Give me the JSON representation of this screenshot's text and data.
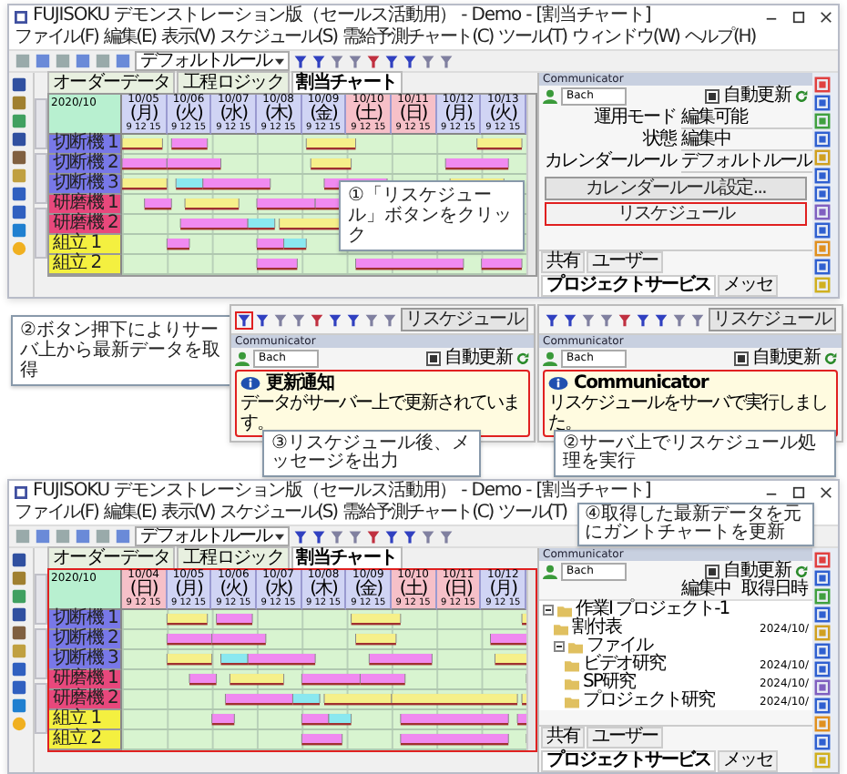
{
  "top_window": {
    "title": "FUJISOKU デモンストレーション版（セールス活動用） - Demo - [割当チャート]",
    "menu": [
      "ファイル(F)",
      "編集(E)",
      "表示(V)",
      "スケジュール(S)",
      "需給予測チャート(C)",
      "ツール(T)",
      "ウィンドウ(W)",
      "ヘルプ(H)"
    ],
    "rule_select": "デフォルトルール",
    "tabs": [
      {
        "label": "オーダーデータ",
        "selected": false
      },
      {
        "label": "工程ロジック",
        "selected": false
      },
      {
        "label": "割当チャート",
        "selected": true
      }
    ],
    "chart": {
      "corner": "2020/10",
      "days": [
        {
          "date": "10/05",
          "day": "(月)",
          "hours": "9 12 15",
          "holiday": false
        },
        {
          "date": "10/06",
          "day": "(火)",
          "hours": "9 12 15",
          "holiday": false
        },
        {
          "date": "10/07",
          "day": "(水)",
          "hours": "9 12 15",
          "holiday": false
        },
        {
          "date": "10/08",
          "day": "(木)",
          "hours": "9 12 15",
          "holiday": false
        },
        {
          "date": "10/09",
          "day": "(金)",
          "hours": "9 12 15",
          "holiday": false
        },
        {
          "date": "10/10",
          "day": "(土)",
          "hours": "9 12 15",
          "holiday": true
        },
        {
          "date": "10/11",
          "day": "(日)",
          "hours": "9 12 15",
          "holiday": true
        },
        {
          "date": "10/12",
          "day": "(月)",
          "hours": "9 12 15",
          "holiday": false
        },
        {
          "date": "10/13",
          "day": "(火)",
          "hours": "9 12 15",
          "holiday": false
        }
      ],
      "resources": [
        {
          "name": "切断機 1",
          "color": "#7878e8"
        },
        {
          "name": "切断機 2",
          "color": "#7878e8"
        },
        {
          "name": "切断機 3",
          "color": "#7878e8"
        },
        {
          "name": "研磨機 1",
          "color": "#e8487c"
        },
        {
          "name": "研磨機 2",
          "color": "#e8487c"
        },
        {
          "name": "組立 1",
          "color": "#f4f040"
        },
        {
          "name": "組立 2",
          "color": "#f4f040"
        }
      ]
    },
    "communicator": {
      "title": "Communicator",
      "user": "Bach",
      "auto_update": {
        "label": "自動更新",
        "checked": true
      },
      "fields": [
        {
          "label": "運用モード",
          "value": "編集可能"
        },
        {
          "label": "状態",
          "value": "編集中"
        },
        {
          "label": "カレンダールール",
          "value": "デフォルトルール"
        }
      ],
      "buttons": [
        {
          "label": "カレンダールール設定...",
          "highlighted": false
        },
        {
          "label": "リスケジュール",
          "highlighted": true
        }
      ],
      "tabs": [
        {
          "label": "共有",
          "selected": false
        },
        {
          "label": "ユーザー",
          "selected": false
        },
        {
          "label": "プロジェクトサービス",
          "selected": true
        },
        {
          "label": "メッセ",
          "selected": false
        }
      ]
    },
    "callout": "①「リスケジュール」ボタンをクリック"
  },
  "middle": {
    "callout_left": "②ボタン押下によりサーバ上から最新データを取得",
    "left_snippet": {
      "title": "Communicator",
      "user": "Bach",
      "auto_update": {
        "label": "自動更新",
        "checked": true
      },
      "popup": {
        "title": "更新通知",
        "message": "データがサーバー上で更新されています。"
      },
      "button": "リスケジュール"
    },
    "callout_center": "③リスケジュール後、メッセージを出力",
    "right_snippet": {
      "title": "Communicator",
      "user": "Bach",
      "auto_update": {
        "label": "自動更新",
        "checked": true
      },
      "popup": {
        "title": "Communicator",
        "message": "リスケジュールをサーバで実行しました。"
      },
      "button": "リスケジュール"
    },
    "callout_right": "②サーバ上でリスケジュール処理を実行"
  },
  "bottom_window": {
    "title": "FUJISOKU デモンストレーション版（セールス活動用） - Demo - [割当チャート]",
    "menu": [
      "ファイル(F)",
      "編集(E)",
      "表示(V)",
      "スケジュール(S)",
      "需給予測チャート(C)",
      "ツール(T)"
    ],
    "rule_select": "デフォルトルール",
    "tabs": [
      {
        "label": "オーダーデータ",
        "selected": false
      },
      {
        "label": "工程ロジック",
        "selected": false
      },
      {
        "label": "割当チャート",
        "selected": true
      }
    ],
    "chart": {
      "corner": "2020/10",
      "days": [
        {
          "date": "10/04",
          "day": "(日)",
          "hours": "9 12 15",
          "holiday": true
        },
        {
          "date": "10/05",
          "day": "(月)",
          "hours": "9 12 15",
          "holiday": false
        },
        {
          "date": "10/06",
          "day": "(火)",
          "hours": "9 12 15",
          "holiday": false
        },
        {
          "date": "10/07",
          "day": "(水)",
          "hours": "9 12 15",
          "holiday": false
        },
        {
          "date": "10/08",
          "day": "(木)",
          "hours": "9 12 15",
          "holiday": false
        },
        {
          "date": "10/09",
          "day": "(金)",
          "hours": "9 12 15",
          "holiday": false
        },
        {
          "date": "10/10",
          "day": "(土)",
          "hours": "9 12 15",
          "holiday": true
        },
        {
          "date": "10/11",
          "day": "(日)",
          "hours": "9 12 15",
          "holiday": true
        },
        {
          "date": "10/12",
          "day": "(月)",
          "hours": "9 12 15",
          "holiday": false
        }
      ],
      "resources": [
        {
          "name": "切断機 1",
          "color": "#7878e8"
        },
        {
          "name": "切断機 2",
          "color": "#7878e8"
        },
        {
          "name": "切断機 3",
          "color": "#7878e8"
        },
        {
          "name": "研磨機 1",
          "color": "#e8487c"
        },
        {
          "name": "研磨機 2",
          "color": "#e8487c"
        },
        {
          "name": "組立 1",
          "color": "#f4f040"
        },
        {
          "name": "組立 2",
          "color": "#f4f040"
        }
      ]
    },
    "communicator": {
      "title": "Communicator",
      "user": "Bach",
      "auto_update": {
        "label": "自動更新",
        "checked": true
      },
      "columns": [
        "編集中",
        "取得日時"
      ],
      "tree": [
        {
          "label": "作業Ⅰ プロジェクト-1",
          "expanded": true,
          "children": [
            {
              "label": "割付表",
              "date": "2024/10/"
            },
            {
              "label": "ファイル",
              "expanded": true,
              "children": [
                {
                  "label": "ビデオ研究",
                  "date": "2024/10/"
                },
                {
                  "label": "SP研究",
                  "date": "2024/10/"
                },
                {
                  "label": "プロジェクト研究",
                  "date": "2024/10/"
                }
              ]
            }
          ]
        }
      ],
      "tabs": [
        {
          "label": "共有",
          "selected": false
        },
        {
          "label": "ユーザー",
          "selected": false
        },
        {
          "label": "プロジェクトサービス",
          "selected": true
        },
        {
          "label": "メッセ",
          "selected": false
        }
      ]
    },
    "callout": "④取得した最新データを元にガントチャートを更新"
  }
}
